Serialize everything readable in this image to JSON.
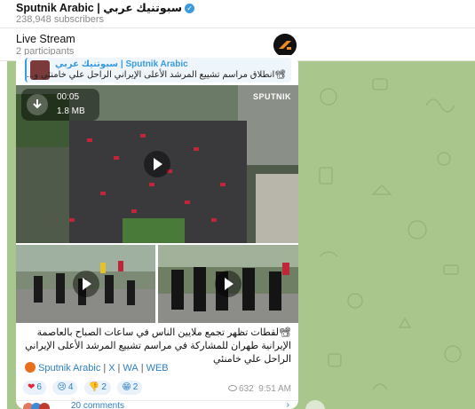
{
  "header": {
    "channel_title": "Sputnik Arabic | سبوتنيك عربي",
    "subscribers": "238,948 subscribers"
  },
  "live_stream": {
    "title": "Live Stream",
    "participants": "2 participants"
  },
  "post": {
    "reply": {
      "name": "سبوتنيك عربي | Sputnik Arabic",
      "text": "📽انطلاق مراسم تشييع المرشد الأعلى الإيراني الراحل علي خامنئي و..."
    },
    "media": {
      "duration": "00:05",
      "size": "1.8 MB",
      "watermark": "SPUTNIK"
    },
    "caption": "📽لقطات تظهر تجمع ملايين الناس في ساعات الصباح بالعاصمة الإيرانية طهران للمشاركة في مراسم تشييع المرشد الأعلى الإيراني الراحل علي خامنئي",
    "links": [
      "Sputnik Arabic",
      "X",
      "WA",
      "WEB"
    ],
    "reactions": [
      {
        "emoji": "❤",
        "count": "6"
      },
      {
        "emoji": "😢",
        "count": "4"
      },
      {
        "emoji": "👎",
        "count": "2"
      },
      {
        "emoji": "😁",
        "count": "2"
      }
    ],
    "views": "632",
    "time": "9:51 AM",
    "comments": "20 comments"
  },
  "colors": {
    "accent": "#2e7fc1",
    "chat_background": "#a9c68c",
    "verified": "#3a9bdc"
  }
}
